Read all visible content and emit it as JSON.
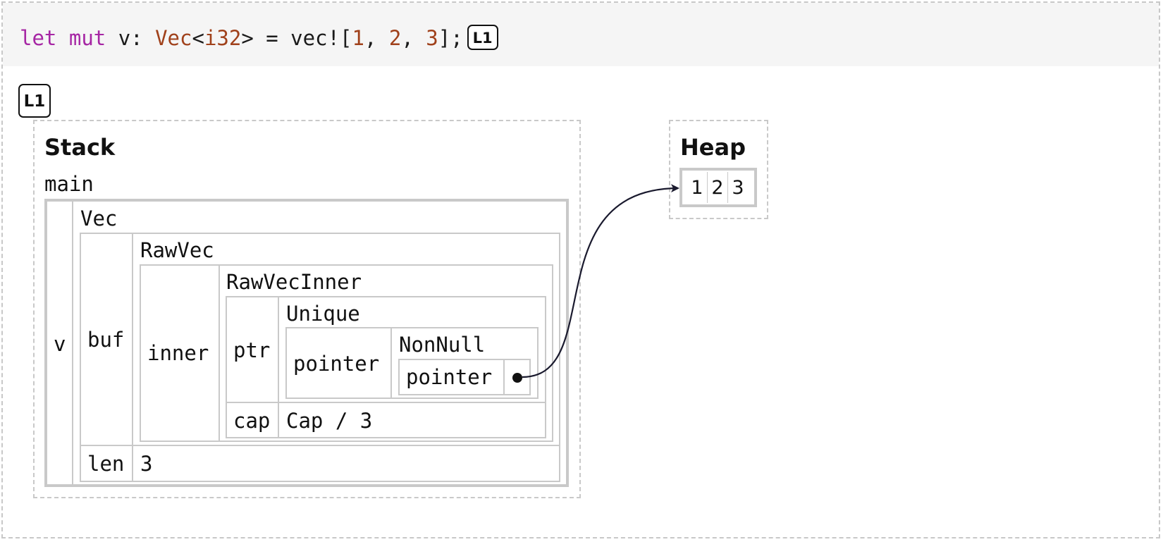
{
  "code": {
    "kw_let": "let",
    "kw_mut": "mut",
    "var_decl": " v: ",
    "type_name": "Vec",
    "lt": "<",
    "type_param": "i32",
    "gt_assign": "> = vec![",
    "elem1": "1",
    "sep1": ", ",
    "elem2": "2",
    "sep2": ", ",
    "elem3": "3",
    "close": "];",
    "badge": "L1"
  },
  "step": {
    "badge": "L1"
  },
  "stack": {
    "title": "Stack",
    "frame": "main",
    "var": "v",
    "vec_type": "Vec",
    "buf_field": "buf",
    "rawvec_type": "RawVec",
    "inner_field": "inner",
    "rawvecinner_type": "RawVecInner",
    "ptr_field": "ptr",
    "unique_type": "Unique",
    "pointer_field": "pointer",
    "nonnull_type": "NonNull",
    "pointer_field_inner": "pointer",
    "cap_field": "cap",
    "cap_value": "Cap / 3",
    "len_field": "len",
    "len_value": "3"
  },
  "heap": {
    "title": "Heap",
    "values": [
      "1",
      "2",
      "3"
    ]
  },
  "colors": {
    "keyword": "#a626a4",
    "type": "#a0411b",
    "number": "#a0411b",
    "border": "#c9c9c9",
    "code_bg": "#f5f5f5"
  }
}
